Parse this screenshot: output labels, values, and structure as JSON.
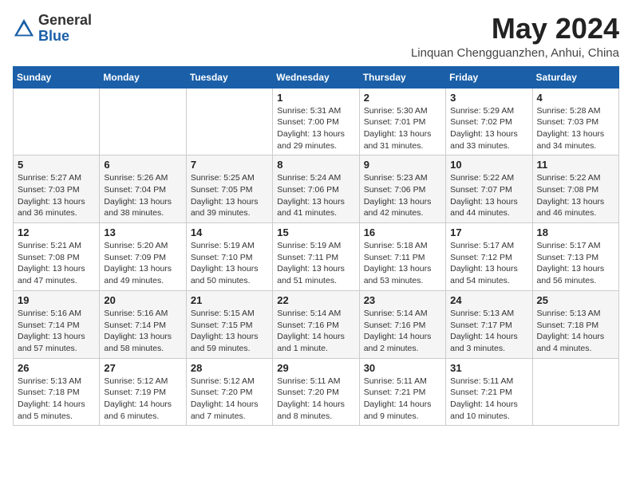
{
  "header": {
    "logo_general": "General",
    "logo_blue": "Blue",
    "month_year": "May 2024",
    "location": "Linquan Chengguanzhen, Anhui, China"
  },
  "days_of_week": [
    "Sunday",
    "Monday",
    "Tuesday",
    "Wednesday",
    "Thursday",
    "Friday",
    "Saturday"
  ],
  "weeks": [
    [
      {
        "day": "",
        "sunrise": "",
        "sunset": "",
        "daylight": ""
      },
      {
        "day": "",
        "sunrise": "",
        "sunset": "",
        "daylight": ""
      },
      {
        "day": "",
        "sunrise": "",
        "sunset": "",
        "daylight": ""
      },
      {
        "day": "1",
        "sunrise": "Sunrise: 5:31 AM",
        "sunset": "Sunset: 7:00 PM",
        "daylight": "Daylight: 13 hours and 29 minutes."
      },
      {
        "day": "2",
        "sunrise": "Sunrise: 5:30 AM",
        "sunset": "Sunset: 7:01 PM",
        "daylight": "Daylight: 13 hours and 31 minutes."
      },
      {
        "day": "3",
        "sunrise": "Sunrise: 5:29 AM",
        "sunset": "Sunset: 7:02 PM",
        "daylight": "Daylight: 13 hours and 33 minutes."
      },
      {
        "day": "4",
        "sunrise": "Sunrise: 5:28 AM",
        "sunset": "Sunset: 7:03 PM",
        "daylight": "Daylight: 13 hours and 34 minutes."
      }
    ],
    [
      {
        "day": "5",
        "sunrise": "Sunrise: 5:27 AM",
        "sunset": "Sunset: 7:03 PM",
        "daylight": "Daylight: 13 hours and 36 minutes."
      },
      {
        "day": "6",
        "sunrise": "Sunrise: 5:26 AM",
        "sunset": "Sunset: 7:04 PM",
        "daylight": "Daylight: 13 hours and 38 minutes."
      },
      {
        "day": "7",
        "sunrise": "Sunrise: 5:25 AM",
        "sunset": "Sunset: 7:05 PM",
        "daylight": "Daylight: 13 hours and 39 minutes."
      },
      {
        "day": "8",
        "sunrise": "Sunrise: 5:24 AM",
        "sunset": "Sunset: 7:06 PM",
        "daylight": "Daylight: 13 hours and 41 minutes."
      },
      {
        "day": "9",
        "sunrise": "Sunrise: 5:23 AM",
        "sunset": "Sunset: 7:06 PM",
        "daylight": "Daylight: 13 hours and 42 minutes."
      },
      {
        "day": "10",
        "sunrise": "Sunrise: 5:22 AM",
        "sunset": "Sunset: 7:07 PM",
        "daylight": "Daylight: 13 hours and 44 minutes."
      },
      {
        "day": "11",
        "sunrise": "Sunrise: 5:22 AM",
        "sunset": "Sunset: 7:08 PM",
        "daylight": "Daylight: 13 hours and 46 minutes."
      }
    ],
    [
      {
        "day": "12",
        "sunrise": "Sunrise: 5:21 AM",
        "sunset": "Sunset: 7:08 PM",
        "daylight": "Daylight: 13 hours and 47 minutes."
      },
      {
        "day": "13",
        "sunrise": "Sunrise: 5:20 AM",
        "sunset": "Sunset: 7:09 PM",
        "daylight": "Daylight: 13 hours and 49 minutes."
      },
      {
        "day": "14",
        "sunrise": "Sunrise: 5:19 AM",
        "sunset": "Sunset: 7:10 PM",
        "daylight": "Daylight: 13 hours and 50 minutes."
      },
      {
        "day": "15",
        "sunrise": "Sunrise: 5:19 AM",
        "sunset": "Sunset: 7:11 PM",
        "daylight": "Daylight: 13 hours and 51 minutes."
      },
      {
        "day": "16",
        "sunrise": "Sunrise: 5:18 AM",
        "sunset": "Sunset: 7:11 PM",
        "daylight": "Daylight: 13 hours and 53 minutes."
      },
      {
        "day": "17",
        "sunrise": "Sunrise: 5:17 AM",
        "sunset": "Sunset: 7:12 PM",
        "daylight": "Daylight: 13 hours and 54 minutes."
      },
      {
        "day": "18",
        "sunrise": "Sunrise: 5:17 AM",
        "sunset": "Sunset: 7:13 PM",
        "daylight": "Daylight: 13 hours and 56 minutes."
      }
    ],
    [
      {
        "day": "19",
        "sunrise": "Sunrise: 5:16 AM",
        "sunset": "Sunset: 7:14 PM",
        "daylight": "Daylight: 13 hours and 57 minutes."
      },
      {
        "day": "20",
        "sunrise": "Sunrise: 5:16 AM",
        "sunset": "Sunset: 7:14 PM",
        "daylight": "Daylight: 13 hours and 58 minutes."
      },
      {
        "day": "21",
        "sunrise": "Sunrise: 5:15 AM",
        "sunset": "Sunset: 7:15 PM",
        "daylight": "Daylight: 13 hours and 59 minutes."
      },
      {
        "day": "22",
        "sunrise": "Sunrise: 5:14 AM",
        "sunset": "Sunset: 7:16 PM",
        "daylight": "Daylight: 14 hours and 1 minute."
      },
      {
        "day": "23",
        "sunrise": "Sunrise: 5:14 AM",
        "sunset": "Sunset: 7:16 PM",
        "daylight": "Daylight: 14 hours and 2 minutes."
      },
      {
        "day": "24",
        "sunrise": "Sunrise: 5:13 AM",
        "sunset": "Sunset: 7:17 PM",
        "daylight": "Daylight: 14 hours and 3 minutes."
      },
      {
        "day": "25",
        "sunrise": "Sunrise: 5:13 AM",
        "sunset": "Sunset: 7:18 PM",
        "daylight": "Daylight: 14 hours and 4 minutes."
      }
    ],
    [
      {
        "day": "26",
        "sunrise": "Sunrise: 5:13 AM",
        "sunset": "Sunset: 7:18 PM",
        "daylight": "Daylight: 14 hours and 5 minutes."
      },
      {
        "day": "27",
        "sunrise": "Sunrise: 5:12 AM",
        "sunset": "Sunset: 7:19 PM",
        "daylight": "Daylight: 14 hours and 6 minutes."
      },
      {
        "day": "28",
        "sunrise": "Sunrise: 5:12 AM",
        "sunset": "Sunset: 7:20 PM",
        "daylight": "Daylight: 14 hours and 7 minutes."
      },
      {
        "day": "29",
        "sunrise": "Sunrise: 5:11 AM",
        "sunset": "Sunset: 7:20 PM",
        "daylight": "Daylight: 14 hours and 8 minutes."
      },
      {
        "day": "30",
        "sunrise": "Sunrise: 5:11 AM",
        "sunset": "Sunset: 7:21 PM",
        "daylight": "Daylight: 14 hours and 9 minutes."
      },
      {
        "day": "31",
        "sunrise": "Sunrise: 5:11 AM",
        "sunset": "Sunset: 7:21 PM",
        "daylight": "Daylight: 14 hours and 10 minutes."
      },
      {
        "day": "",
        "sunrise": "",
        "sunset": "",
        "daylight": ""
      }
    ]
  ]
}
